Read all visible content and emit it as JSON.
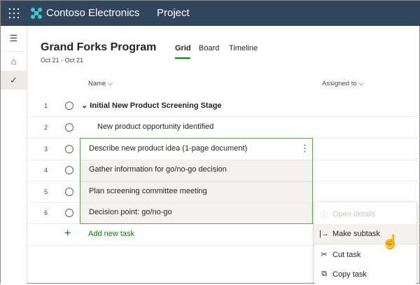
{
  "header": {
    "brand": "Contoso Electronics",
    "app": "Project"
  },
  "project": {
    "title": "Grand Forks Program",
    "dates": "Oct 21 - Oct 21"
  },
  "tabs": [
    {
      "label": "Grid",
      "active": true
    },
    {
      "label": "Board"
    },
    {
      "label": "Timeline"
    }
  ],
  "columns": {
    "name": "Name",
    "assigned": "Assigned to"
  },
  "rows": [
    {
      "num": "1",
      "name": "Initial New Product Screening Stage"
    },
    {
      "num": "2",
      "name": "New product opportunity identified"
    },
    {
      "num": "3",
      "name": "Describe new product idea (1-page document)"
    },
    {
      "num": "4",
      "name": "Gather information for go/no-go decision"
    },
    {
      "num": "5",
      "name": "Plan screening committee meeting"
    },
    {
      "num": "6",
      "name": "Decision point: go/no-go"
    }
  ],
  "add_task": "Add new task",
  "menu": [
    {
      "label": "Open details",
      "icon": "info-icon",
      "disabled": true
    },
    {
      "label": "Make subtask",
      "icon": "indent-icon"
    },
    {
      "label": "Cut task",
      "icon": "scissors-icon"
    },
    {
      "label": "Copy task",
      "icon": "copy-icon"
    }
  ],
  "colors": {
    "header": "#31465c",
    "accent": "#107c10",
    "selection": "#5ea34b"
  }
}
